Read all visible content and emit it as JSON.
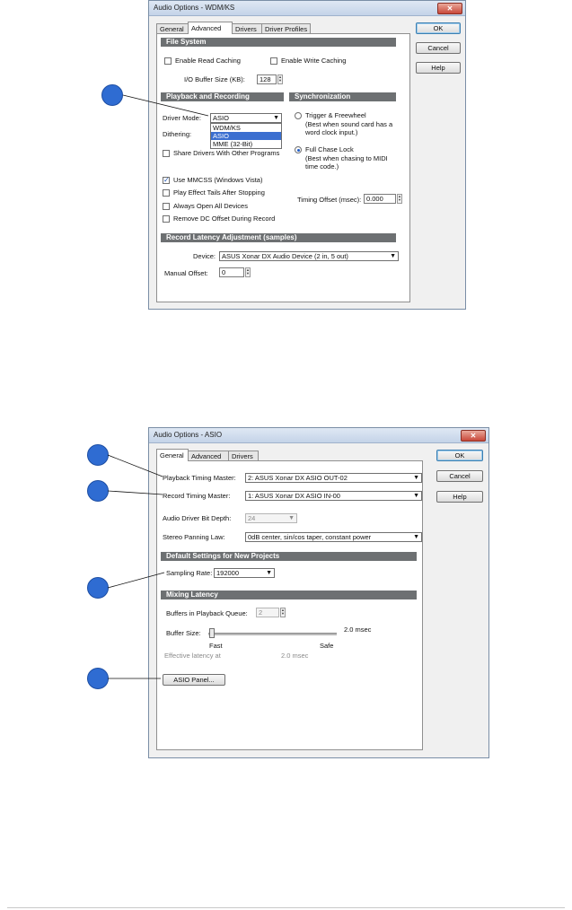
{
  "dialog1": {
    "title": "Audio Options - WDM/KS",
    "tabs": [
      "General",
      "Advanced",
      "Drivers",
      "Driver Profiles"
    ],
    "buttons": {
      "ok": "OK",
      "cancel": "Cancel",
      "help": "Help"
    },
    "file_system": {
      "header": "File System",
      "enable_read_caching": "Enable Read Caching",
      "enable_write_caching": "Enable Write Caching",
      "io_buffer_label": "I/O Buffer Size (KB):",
      "io_buffer_value": "128"
    },
    "playback": {
      "header": "Playback and Recording",
      "driver_mode_label": "Driver Mode:",
      "driver_mode_value": "ASIO",
      "driver_mode_options": [
        "WDM/KS",
        "ASIO",
        "MME (32-Bit)"
      ],
      "dithering_label": "Dithering:",
      "share_drivers": "Share Drivers With Other Programs",
      "use_mmcss": "Use MMCSS (Windows Vista)",
      "play_effect_tails": "Play Effect Tails After Stopping",
      "always_open": "Always Open All Devices",
      "remove_dc": "Remove DC Offset During Record"
    },
    "sync": {
      "header": "Synchronization",
      "trigger_freewheel": "Trigger & Freewheel",
      "trigger_note_1": "(Best when sound card has a",
      "trigger_note_2": "word clock input.)",
      "full_chase": "Full Chase Lock",
      "chase_note_1": "(Best when chasing to MIDI",
      "chase_note_2": "time code.)",
      "timing_offset_label": "Timing Offset (msec):",
      "timing_offset_value": "0.000"
    },
    "record_latency": {
      "header": "Record Latency Adjustment (samples)",
      "device_label": "Device:",
      "device_value": "ASUS Xonar DX Audio Device (2 in, 5 out)",
      "manual_offset_label": "Manual Offset:",
      "manual_offset_value": "0"
    }
  },
  "dialog2": {
    "title": "Audio Options - ASIO",
    "tabs": [
      "General",
      "Advanced",
      "Drivers"
    ],
    "buttons": {
      "ok": "OK",
      "cancel": "Cancel",
      "help": "Help"
    },
    "playback_master_label": "Playback Timing Master:",
    "playback_master_value": "2: ASUS Xonar DX ASIO OUT-02",
    "record_master_label": "Record Timing Master:",
    "record_master_value": "1: ASUS Xonar DX ASIO IN-00",
    "bit_depth_label": "Audio Driver Bit Depth:",
    "bit_depth_value": "24",
    "panning_label": "Stereo Panning Law:",
    "panning_value": "0dB center, sin/cos taper, constant power",
    "defaults_header": "Default Settings for New Projects",
    "sampling_label": "Sampling Rate:",
    "sampling_value": "192000",
    "mixing_header": "Mixing Latency",
    "buffers_label": "Buffers in Playback Queue:",
    "buffers_value": "2",
    "buffer_size_label": "Buffer Size:",
    "buffer_size_value": "2.0 msec",
    "fast_label": "Fast",
    "safe_label": "Safe",
    "effective_label": "Effective latency at",
    "effective_value": "2.0 msec",
    "asio_panel": "ASIO Panel..."
  },
  "colors": {
    "callout": "#2f6cd2",
    "section_header": "#6d7072",
    "selection": "#3b6fd0"
  }
}
